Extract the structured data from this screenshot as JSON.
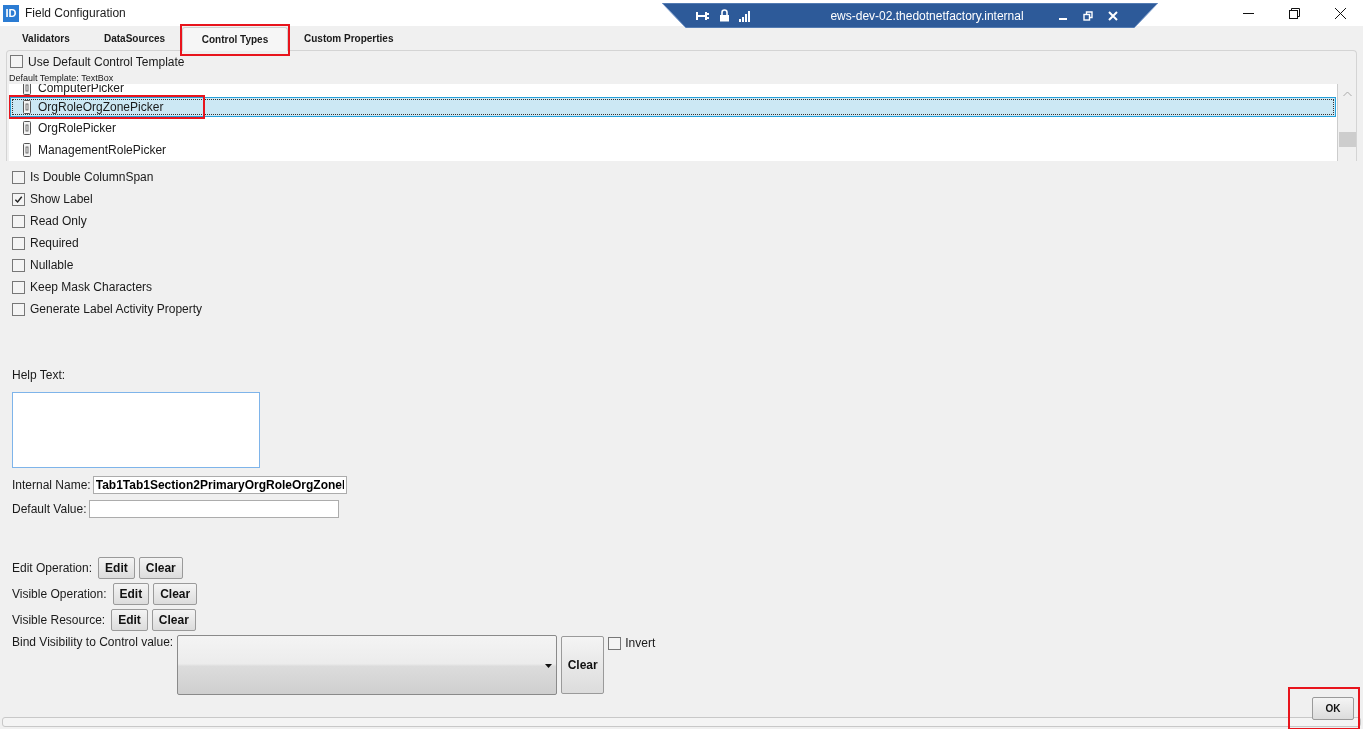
{
  "window": {
    "title": "Field Configuration",
    "app_icon_text": "ID"
  },
  "remote_bar": {
    "host": "ews-dev-02.thedotnetfactory.internal"
  },
  "tabs": [
    {
      "label": "Validators",
      "selected": false,
      "highlighted": false
    },
    {
      "label": "DataSources",
      "selected": false,
      "highlighted": false
    },
    {
      "label": "Control Types",
      "selected": true,
      "highlighted": true
    },
    {
      "label": "Custom Properties",
      "selected": false,
      "highlighted": false
    }
  ],
  "use_default_template": {
    "label": "Use Default Control Template",
    "checked": false
  },
  "default_template": "Default Template: TextBox",
  "control_list": [
    {
      "label": "ComputerPicker",
      "selected": false,
      "highlighted": false
    },
    {
      "label": "OrgRoleOrgZonePicker",
      "selected": true,
      "highlighted": true
    },
    {
      "label": "OrgRolePicker",
      "selected": false,
      "highlighted": false
    },
    {
      "label": "ManagementRolePicker",
      "selected": false,
      "highlighted": false
    }
  ],
  "options": [
    {
      "label": "Is Double ColumnSpan",
      "checked": false
    },
    {
      "label": "Show Label",
      "checked": true
    },
    {
      "label": "Read Only",
      "checked": false
    },
    {
      "label": "Required",
      "checked": false
    },
    {
      "label": "Nullable",
      "checked": false
    },
    {
      "label": "Keep Mask Characters",
      "checked": false
    },
    {
      "label": "Generate Label Activity Property",
      "checked": false
    }
  ],
  "help_text": {
    "label": "Help Text:"
  },
  "internal_name": {
    "label": "Internal Name:",
    "value": "Tab1Tab1Section2PrimaryOrgRoleOrgZoneI"
  },
  "default_value": {
    "label": "Default Value:"
  },
  "operations": [
    {
      "label": "Edit Operation:",
      "buttons": [
        "Edit",
        "Clear"
      ]
    },
    {
      "label": "Visible Operation:",
      "buttons": [
        "Edit",
        "Clear"
      ]
    },
    {
      "label": "Visible Resource:",
      "buttons": [
        "Edit",
        "Clear"
      ]
    }
  ],
  "bind_visibility": {
    "label": "Bind Visibility to Control value:",
    "clear": "Clear",
    "invert": {
      "label": "Invert",
      "checked": false
    }
  },
  "ok_button": {
    "label": "OK",
    "highlighted": true
  }
}
